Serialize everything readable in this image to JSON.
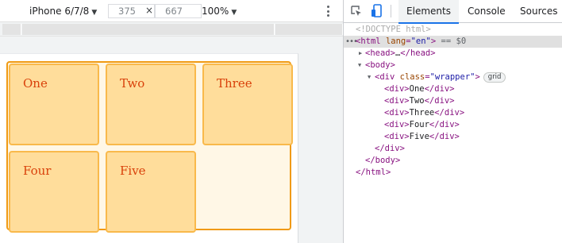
{
  "device_toolbar": {
    "device": "iPhone 6/7/8",
    "width": "375",
    "height": "667",
    "dim_separator": "×",
    "zoom": "100%",
    "caret": "▼"
  },
  "page": {
    "boxes": [
      "One",
      "Two",
      "Three",
      "Four",
      "Five"
    ]
  },
  "devtools": {
    "tabs": [
      "Elements",
      "Console",
      "Sources"
    ],
    "active_tab": "Elements",
    "accent_color": "#1a73e8",
    "dom": {
      "doctype": "<!DOCTYPE html>",
      "html_open_tag": "html",
      "html_attr_name": "lang",
      "html_attr_value": "\"en\"",
      "selected_suffix": "== $0",
      "head_tag": "head",
      "head_collapsed": "…",
      "body_tag": "body",
      "div_tag": "div",
      "wrapper_attr_name": "class",
      "wrapper_attr_value": "\"wrapper\"",
      "grid_badge": "grid",
      "children": [
        "One",
        "Two",
        "Three",
        "Four",
        "Five"
      ]
    }
  },
  "colors": {
    "wrapper_border": "#f09a13",
    "wrapper_bg": "#fff7e6",
    "box_bg": "#ffdd9b",
    "box_border": "#f9b94b",
    "box_text": "#d9410b"
  }
}
